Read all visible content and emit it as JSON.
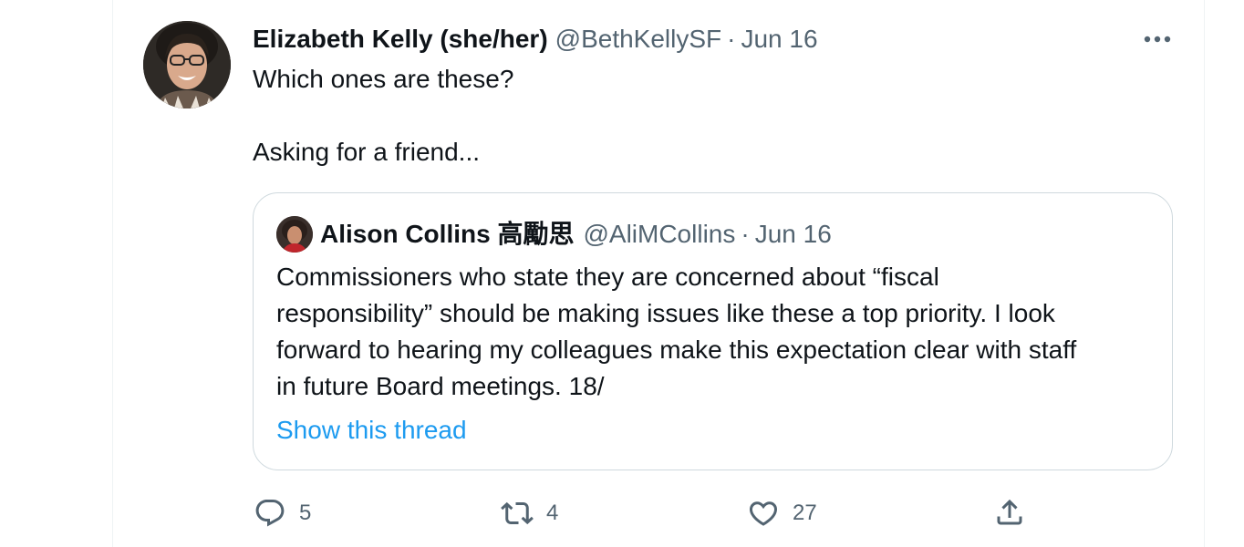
{
  "tweet": {
    "author_name": "Elizabeth Kelly (she/her)",
    "handle": "@BethKellySF",
    "separator": "·",
    "date": "Jun 16",
    "text_line1": "Which ones are these?",
    "text_line2": "Asking for a friend..."
  },
  "quoted_tweet": {
    "author_name": "Alison Collins 高勵思",
    "handle": "@AliMCollins",
    "separator": "·",
    "date": "Jun 16",
    "body_lines": [
      "Commissioners who state they are concerned about “fiscal",
      "responsibility” should be making issues like these a top priority. I look",
      "forward to hearing my colleagues make this expectation clear with staff",
      "in future Board meetings. 18/"
    ],
    "show_thread": "Show this thread"
  },
  "actions": {
    "reply_count": "5",
    "retweet_count": "4",
    "like_count": "27"
  },
  "icons": {
    "more": "more-horizontal-icon",
    "reply": "reply-icon",
    "retweet": "retweet-icon",
    "like": "heart-icon",
    "share": "share-icon"
  },
  "colors": {
    "text": "#0f1419",
    "secondary": "#536471",
    "link": "#1d9bf0",
    "border": "#cfd9de"
  }
}
